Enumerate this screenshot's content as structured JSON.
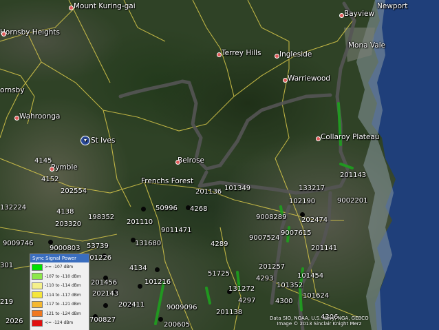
{
  "places": [
    {
      "id": "mount-kuring-gai",
      "label": "Mount Kuring-gai"
    },
    {
      "id": "hornsby-heights",
      "label": "Hornsby Heights"
    },
    {
      "id": "hornsby",
      "label": "ornsby"
    },
    {
      "id": "wahroonga",
      "label": "Wahroonga"
    },
    {
      "id": "st-ives",
      "label": "St Ives"
    },
    {
      "id": "pymble",
      "label": "Pymble"
    },
    {
      "id": "belrose",
      "label": "Belrose"
    },
    {
      "id": "frenchs-forest",
      "label": "Frenchs Forest"
    },
    {
      "id": "terrey-hills",
      "label": "Terrey Hills"
    },
    {
      "id": "ingleside",
      "label": "Ingleside"
    },
    {
      "id": "warriewood",
      "label": "Warriewood"
    },
    {
      "id": "mona-vale",
      "label": "Mona Vale"
    },
    {
      "id": "bayview",
      "label": "Bayview"
    },
    {
      "id": "newport",
      "label": "Newport"
    },
    {
      "id": "collaroy-plateau",
      "label": "Collaroy Plateau"
    }
  ],
  "sites": [
    "4145",
    "4152",
    "202554",
    "4138",
    "203320",
    "198352",
    "132224",
    "9009746",
    "9000803",
    "53739",
    "201226",
    "50996",
    "4268",
    "201110",
    "9011471",
    "131680",
    "4134",
    "101216",
    "201456",
    "202143",
    "202411",
    "9009096",
    "700827",
    "200605",
    "201138",
    "4297",
    "131272",
    "51725",
    "4293",
    "4289",
    "201257",
    "101352",
    "101454",
    "4300",
    "101624",
    "4306",
    "9007524",
    "9007615",
    "9008289",
    "202474",
    "102190",
    "201141",
    "9002201",
    "201143",
    "101349",
    "201136",
    "133217",
    "2026",
    "219",
    "301"
  ],
  "legend": {
    "title": "Sync Signal Power",
    "items": [
      {
        "label": ">= -107 dBm",
        "color": "#00e000"
      },
      {
        "label": "-107 to -110 dBm",
        "color": "#8de84a"
      },
      {
        "label": "-110 to -114 dBm",
        "color": "#f4f08a"
      },
      {
        "label": "-114 to -117 dBm",
        "color": "#f5e63c"
      },
      {
        "label": "-117 to -121 dBm",
        "color": "#f5b830"
      },
      {
        "label": "-121 to -124 dBm",
        "color": "#f07820"
      },
      {
        "label": "<= -124 dBm",
        "color": "#e01010"
      }
    ]
  },
  "attribution": {
    "line1": "Data SIO, NOAA, U.S. Navy, NGA, GEBCO",
    "line2": "Image © 2013 Sinclair Knight Merz"
  }
}
